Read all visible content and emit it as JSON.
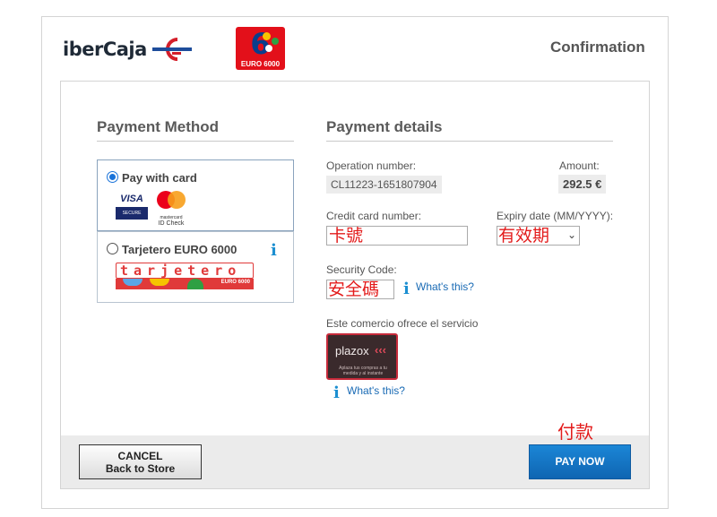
{
  "header": {
    "bank_logo_text": "iberCaja",
    "network_logo_number": "6",
    "network_logo_caption": "EURO 6000",
    "title": "Confirmation"
  },
  "payment_method": {
    "heading": "Payment Method",
    "options": [
      {
        "label": "Pay with card",
        "selected": true,
        "brands": [
          {
            "icon": "visa-secure-icon",
            "text": "VISA",
            "subtext": "SECURE"
          },
          {
            "icon": "mastercard-id-check-icon",
            "subtext": "mastercard",
            "text": "ID Check"
          }
        ]
      },
      {
        "label": "Tarjetero EURO 6000",
        "selected": false,
        "has_info": true,
        "brand": {
          "icon": "tarjetero-logo-icon",
          "text": "tarjetero",
          "caption": "EURO 6000"
        }
      }
    ]
  },
  "payment_details": {
    "heading": "Payment details",
    "operation_number": {
      "label": "Operation number:",
      "value": "CL11223-1651807904"
    },
    "amount": {
      "label": "Amount:",
      "value": "292.5 €"
    },
    "card_number": {
      "label": "Credit card number:",
      "annotation": "卡號"
    },
    "expiry": {
      "label": "Expiry date (MM/YYYY):",
      "annotation": "有效期"
    },
    "security_code": {
      "label": "Security Code:",
      "annotation": "安全碼",
      "help_link": "What's this?"
    },
    "financing": {
      "label": "Este comercio ofrece el servicio",
      "logo_text": "plazox",
      "logo_subtext": "Aplaza tus compras a tu medida y al instante",
      "help_link": "What's this?"
    }
  },
  "footer": {
    "cancel_line1": "CANCEL",
    "cancel_line2": "Back to Store",
    "pay_label": "PAY NOW",
    "pay_annotation": "付款"
  },
  "colors": {
    "accent": "#1a73d9",
    "pay_button": "#1176c6",
    "annotation": "#e31b1b",
    "info_icon": "#1c8fd1"
  }
}
